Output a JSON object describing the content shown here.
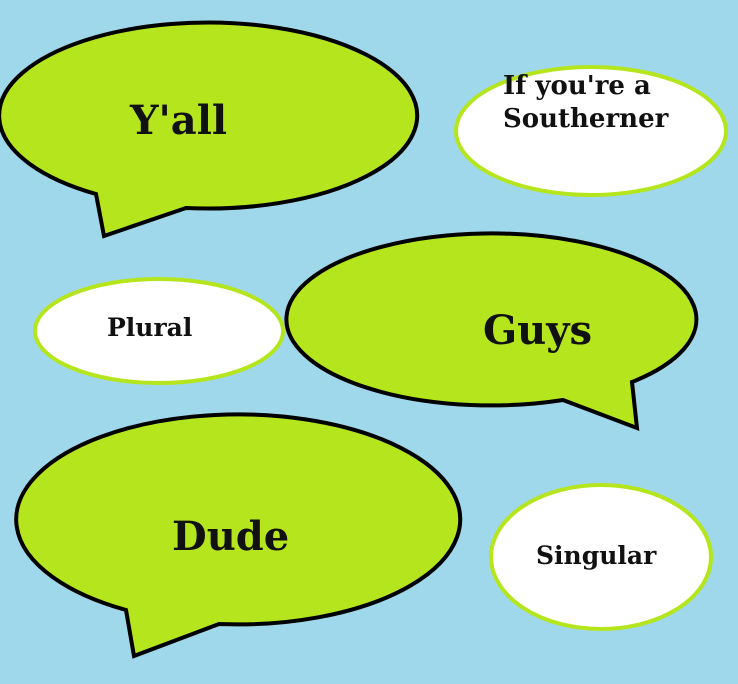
{
  "colors": {
    "background": "#9ed8ea",
    "green_bubble": "#b5e61d",
    "outline": "#000000",
    "white_bubble_outline": "#b5e61d"
  },
  "bubbles": {
    "yall": "Y'all",
    "guys": "Guys",
    "dude": "Dude",
    "southerner_line1": "If you're a",
    "southerner_line2": "Southerner",
    "plural": "Plural",
    "singular": "Singular"
  }
}
